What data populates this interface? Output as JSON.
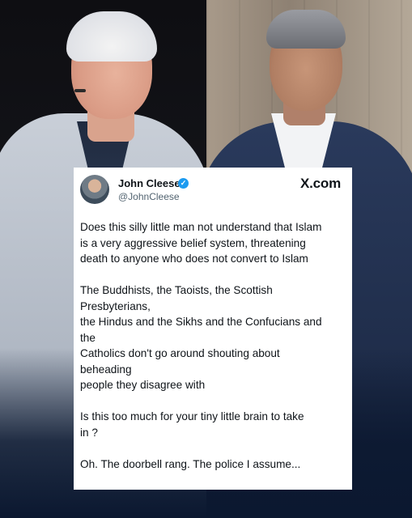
{
  "source": "X.com",
  "author": {
    "name": "John Cleese",
    "handle": "@JohnCleese",
    "verified_badge": "✓"
  },
  "paragraphs": [
    [
      "Does this silly little man not understand that Islam",
      "is a very aggressive belief system, threatening",
      "death to anyone who does not convert to Islam"
    ],
    [
      "The Buddhists, the Taoists, the Scottish",
      "Presbyterians,",
      "the Hindus and the Sikhs and the Confucians and",
      "the",
      "Catholics don't go around shouting about",
      "beheading",
      "people they disagree with"
    ],
    [
      "Is this too much for your tiny little brain to take",
      "in ?"
    ],
    [
      "Oh. The doorbell rang. The police I assume..."
    ]
  ],
  "colors": {
    "background": "#0b1830",
    "card": "#ffffff",
    "verified": "#1d9bf0",
    "text": "#0f1419",
    "muted": "#536471"
  }
}
